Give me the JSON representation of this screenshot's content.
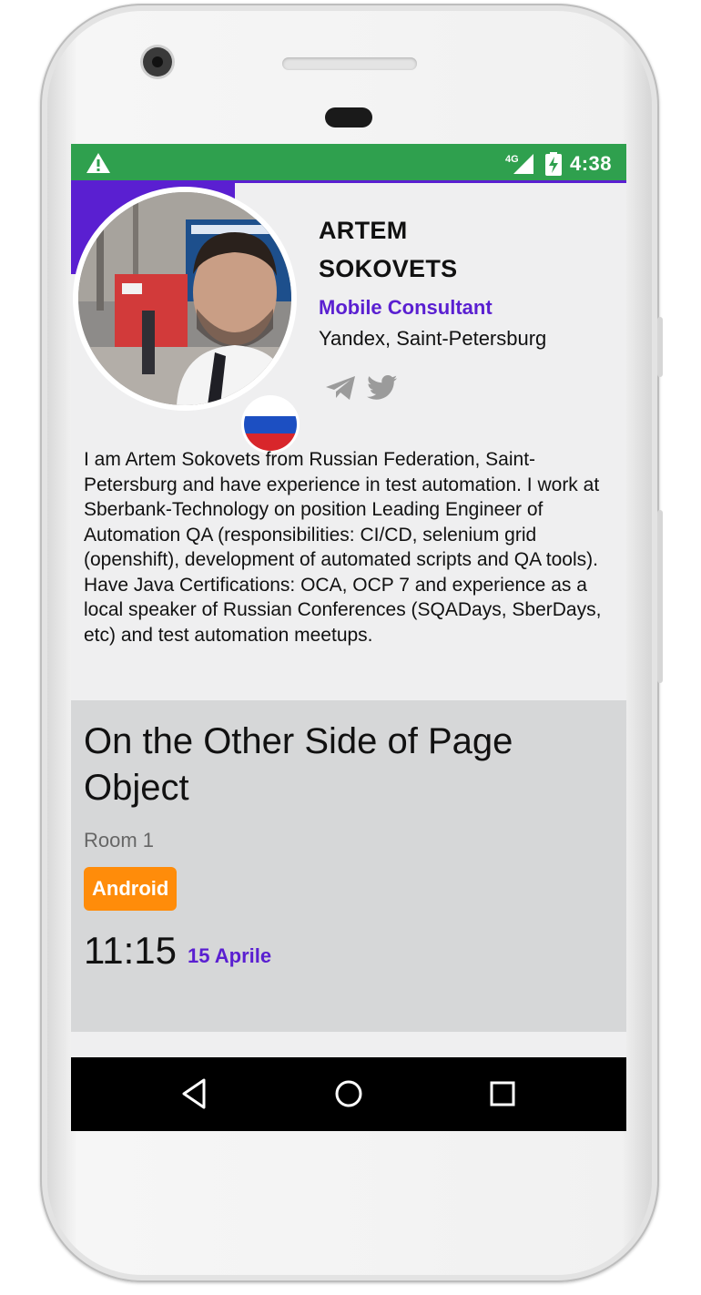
{
  "status_bar": {
    "network": "4G",
    "time": "4:38"
  },
  "speaker": {
    "first_name": "ARTEM",
    "last_name": "SOKOVETS",
    "role": "Mobile Consultant",
    "company": "Yandex, Saint-Petersburg",
    "bio": "I am Artem Sokovets from Russian Federation, Saint-Petersburg and have experience in test automation. I work at Sberbank-Technology on position Leading Engineer of Automation QA (responsibilities: CI/CD, selenium grid (openshift), development of automated scripts and QA tools). Have Java Certifications: OCA, OCP 7 and experience as a local speaker of Russian Conferences (SQADays, SberDays, etc) and test automation meetups."
  },
  "session": {
    "title": "On the Other Side of Page Object",
    "room": "Room 1",
    "tag": "Android",
    "time": "11:15",
    "date": "15 Aprile"
  },
  "icons": [
    "warning-icon",
    "signal-icon",
    "battery-charging-icon",
    "telegram-icon",
    "twitter-icon",
    "nav-back-icon",
    "nav-home-icon",
    "nav-recents-icon"
  ],
  "colors": {
    "status_bar": "#2fa04e",
    "accent": "#5a1fd1",
    "tag": "#ff8c0a",
    "card": "#d6d7d8"
  }
}
